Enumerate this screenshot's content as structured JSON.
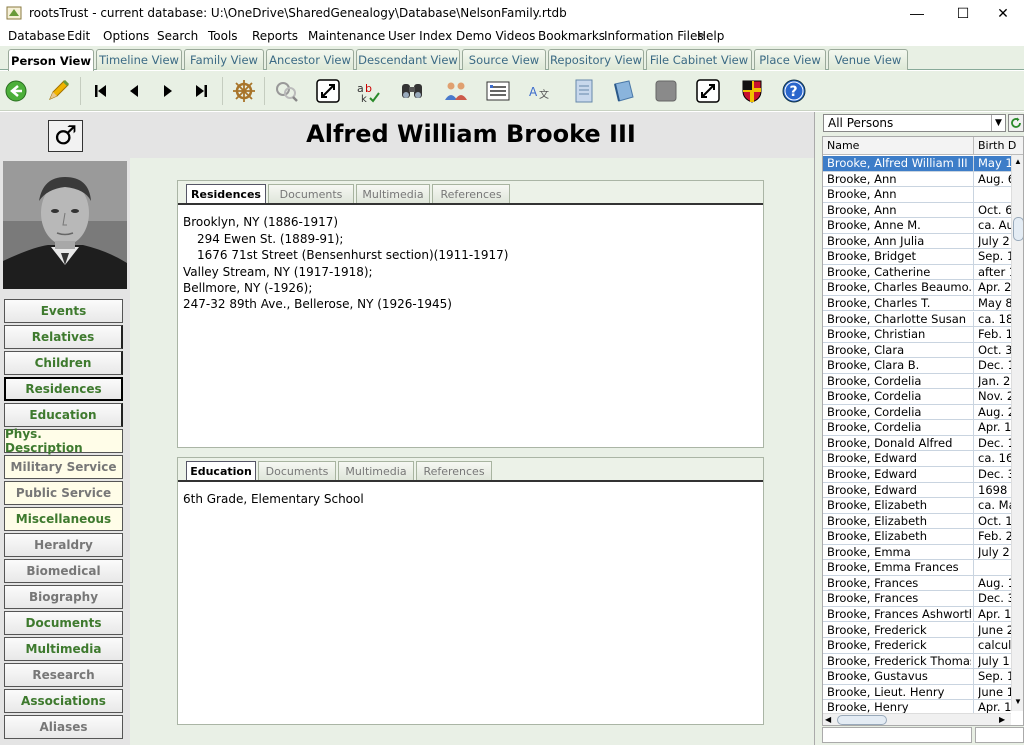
{
  "window": {
    "title": "rootsTrust - current database: U:\\OneDrive\\SharedGenealogy\\Database\\NelsonFamily.rtdb",
    "minimize": "—",
    "maximize": "☐",
    "close": "✕"
  },
  "menu": [
    "Database",
    "Edit",
    "Options",
    "Search",
    "Tools",
    "Reports",
    "Maintenance",
    "User Index",
    "Demo Videos",
    "Bookmarks",
    "Information Files",
    "Help"
  ],
  "view_tabs": [
    "Person View",
    "Timeline View",
    "Family View",
    "Ancestor View",
    "Descendant View",
    "Source View",
    "Repository View",
    "File Cabinet View",
    "Place View",
    "Venue View"
  ],
  "toolbar_icons": [
    "back-arrow-icon",
    "pencil-icon",
    "first-record-icon",
    "previous-record-icon",
    "next-record-icon",
    "last-record-icon",
    "ship-wheel-icon",
    "search-people-icon",
    "expand-icon",
    "spellcheck-icon",
    "binoculars-icon",
    "people-icon",
    "list-icon",
    "translate-icon",
    "document-icon",
    "book-icon",
    "gray-square-icon",
    "fullscreen-icon",
    "shield-icon",
    "help-icon"
  ],
  "person": {
    "sex_symbol": "♂",
    "name": "Alfred William Brooke III"
  },
  "nav": [
    {
      "label": "Events",
      "style": "green"
    },
    {
      "label": "Relatives",
      "style": "green"
    },
    {
      "label": "Children",
      "style": "green"
    },
    {
      "label": "Residences",
      "style": "green"
    },
    {
      "label": "Education",
      "style": "green"
    },
    {
      "label": "Phys. Description",
      "style": "green"
    },
    {
      "label": "Military Service",
      "style": "gray"
    },
    {
      "label": "Public Service",
      "style": "gray"
    },
    {
      "label": "Miscellaneous",
      "style": "green"
    },
    {
      "label": "Heraldry",
      "style": "gray"
    },
    {
      "label": "Biomedical",
      "style": "gray"
    },
    {
      "label": "Biography",
      "style": "gray"
    },
    {
      "label": "Documents",
      "style": "green"
    },
    {
      "label": "Multimedia",
      "style": "green"
    },
    {
      "label": "Research",
      "style": "gray"
    },
    {
      "label": "Associations",
      "style": "green"
    },
    {
      "label": "Aliases",
      "style": "gray"
    }
  ],
  "residences_panel": {
    "tabs": [
      "Residences",
      "Documents",
      "Multimedia",
      "References"
    ],
    "lines": [
      "Brooklyn, NY (1886-1917)",
      "294 Ewen St. (1889-91);",
      "1676 71st Street (Bensenhurst section)(1911-1917)",
      "Valley Stream, NY (1917-1918);",
      "Bellmore, NY (-1926);",
      "247-32 89th Ave., Bellerose, NY (1926-1945)"
    ]
  },
  "education_panel": {
    "tabs": [
      "Education",
      "Documents",
      "Multimedia",
      "References"
    ],
    "lines": [
      "6th Grade, Elementary School"
    ]
  },
  "person_list": {
    "filter": "All Persons",
    "col_name": "Name",
    "col_birth": "Birth D",
    "rows": [
      {
        "name": "Brooke, Alfred William III",
        "birth": "May 1"
      },
      {
        "name": "Brooke, Ann",
        "birth": "Aug. 6"
      },
      {
        "name": "Brooke, Ann",
        "birth": ""
      },
      {
        "name": "Brooke, Ann",
        "birth": "Oct. 6"
      },
      {
        "name": "Brooke, Anne M.",
        "birth": "ca. Au"
      },
      {
        "name": "Brooke, Ann Julia",
        "birth": "July 2"
      },
      {
        "name": "Brooke, Bridget",
        "birth": "Sep. 1"
      },
      {
        "name": "Brooke, Catherine",
        "birth": "after 1"
      },
      {
        "name": "Brooke, Charles Beaumo...",
        "birth": "Apr. 2"
      },
      {
        "name": "Brooke, Charles T.",
        "birth": "May 8"
      },
      {
        "name": "Brooke, Charlotte Susan",
        "birth": "ca. 18"
      },
      {
        "name": "Brooke, Christian",
        "birth": "Feb. 1"
      },
      {
        "name": "Brooke, Clara",
        "birth": "Oct. 3"
      },
      {
        "name": "Brooke, Clara B.",
        "birth": "Dec. 1"
      },
      {
        "name": "Brooke, Cordelia",
        "birth": "Jan. 2"
      },
      {
        "name": "Brooke, Cordelia",
        "birth": "Nov. 2"
      },
      {
        "name": "Brooke, Cordelia",
        "birth": "Aug. 2"
      },
      {
        "name": "Brooke, Cordelia",
        "birth": "Apr. 1"
      },
      {
        "name": "Brooke, Donald Alfred",
        "birth": "Dec. 1"
      },
      {
        "name": "Brooke, Edward",
        "birth": "ca. 16"
      },
      {
        "name": "Brooke, Edward",
        "birth": "Dec. 3"
      },
      {
        "name": "Brooke, Edward",
        "birth": "1698"
      },
      {
        "name": "Brooke, Elizabeth",
        "birth": "ca. Ma"
      },
      {
        "name": "Brooke, Elizabeth",
        "birth": "Oct. 1"
      },
      {
        "name": "Brooke, Elizabeth",
        "birth": "Feb. 2"
      },
      {
        "name": "Brooke, Emma",
        "birth": "July 2"
      },
      {
        "name": "Brooke, Emma Frances",
        "birth": ""
      },
      {
        "name": "Brooke, Frances",
        "birth": "Aug. 1"
      },
      {
        "name": "Brooke, Frances",
        "birth": "Dec. 3"
      },
      {
        "name": "Brooke, Frances Ashworth",
        "birth": "Apr. 1"
      },
      {
        "name": "Brooke, Frederick",
        "birth": "June 2"
      },
      {
        "name": "Brooke, Frederick",
        "birth": "calcul"
      },
      {
        "name": "Brooke, Frederick Thomas",
        "birth": "July 1"
      },
      {
        "name": "Brooke, Gustavus",
        "birth": "Sep. 1"
      },
      {
        "name": "Brooke, Lieut. Henry",
        "birth": "June 1"
      },
      {
        "name": "Brooke, Henry",
        "birth": "Apr. 1"
      }
    ]
  },
  "colors": {
    "accent_green": "#3e7a2e",
    "selection_blue": "#3d7dc8",
    "tab_text": "#3b6a84"
  }
}
